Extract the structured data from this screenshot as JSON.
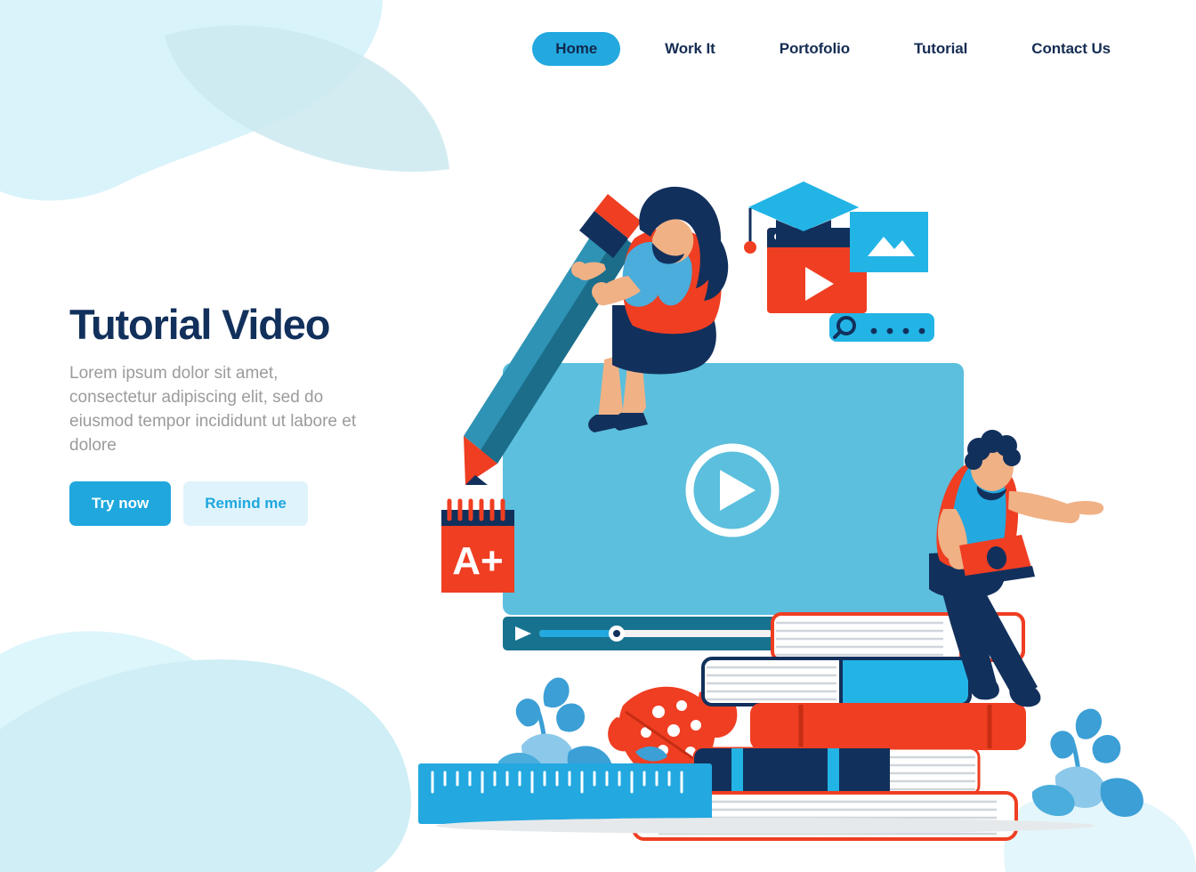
{
  "nav": {
    "items": [
      {
        "label": "Home",
        "active": true
      },
      {
        "label": "Work It",
        "active": false
      },
      {
        "label": "Portofolio",
        "active": false
      },
      {
        "label": "Tutorial",
        "active": false
      },
      {
        "label": "Contact Us",
        "active": false
      }
    ]
  },
  "hero": {
    "title": "Tutorial Video",
    "description": "Lorem ipsum dolor sit amet, consectetur adipiscing elit, sed do eiusmod tempor incididunt ut labore et dolore",
    "primary_button": "Try now",
    "secondary_button": "Remind me"
  },
  "illustration": {
    "notepad_grade": "A+",
    "video_player": {
      "play_icon": "play-circle-icon",
      "control_play_icon": "play-triangle-icon",
      "progress_percent": 34
    },
    "icons": {
      "graduation_cap": "graduation-cap-icon",
      "browser_video": "browser-play-icon",
      "image_card": "image-placeholder-icon",
      "search_bar": "search-icon",
      "search_dots": 4
    },
    "characters": [
      {
        "name": "woman-with-pencil"
      },
      {
        "name": "man-with-laptop"
      }
    ],
    "books_count": 5
  },
  "colors": {
    "brand_blue": "#1fa7de",
    "nav_pill": "#23a8e0",
    "navy": "#12305c",
    "red": "#ef3e22",
    "sky": "#5bbfdd",
    "teal_dark": "#17728f",
    "pale_cyan": "#d6f2f8",
    "light_blue_btn": "#dff3fc",
    "muted_text": "#9b9b9b"
  }
}
